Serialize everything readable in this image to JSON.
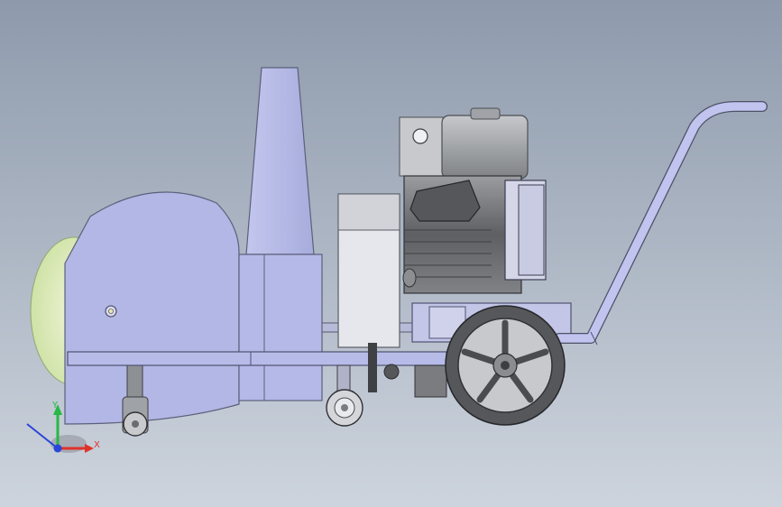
{
  "viewport": {
    "background_top": "#8e9aac",
    "background_bottom": "#cdd4dd",
    "part_color": "#b3b8e6",
    "motor_color": "#6d6f72",
    "wheel_color": "#5f6166"
  },
  "triad": {
    "y_label": "Y",
    "x_label": "X",
    "y_color": "#27b845",
    "x_color": "#e0322a",
    "z_color": "#2a45d8"
  }
}
